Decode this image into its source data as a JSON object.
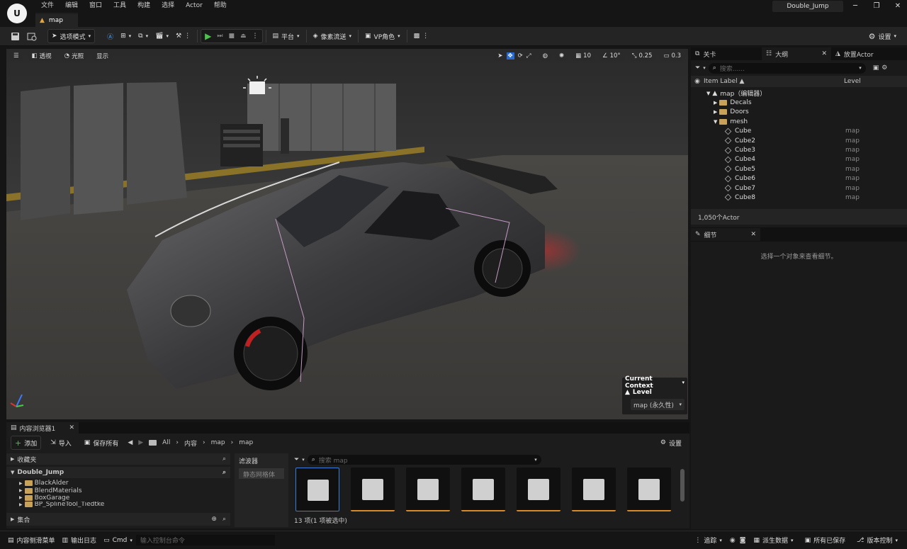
{
  "menu": [
    "文件",
    "编辑",
    "窗口",
    "工具",
    "构建",
    "选择",
    "Actor",
    "帮助"
  ],
  "level_tab": "map",
  "project_name": "Double_Jump",
  "window_controls": {
    "minimize": "─",
    "maximize": "❐",
    "close": "✕"
  },
  "toolbar": {
    "mode": "选项模式",
    "platform": "平台",
    "pixel_streaming": "像素流送",
    "vp_role": "VP角色",
    "settings": "设置"
  },
  "viewport": {
    "perspective": "透视",
    "lit": "光照",
    "show": "显示",
    "grid_snap": "10",
    "rot_snap": "10°",
    "scale_snap": "0.25",
    "cam_speed": "0.3",
    "context_title": "Current Context",
    "context_level_label": "Level",
    "context_level_value": "map (永久性)"
  },
  "right_tabs": {
    "level": "关卡",
    "outliner": "大纲",
    "place": "放置Actor"
  },
  "outliner": {
    "search_placeholder": "搜索......",
    "col_label": "Item Label ▲",
    "col_level": "Level",
    "root": "map（编辑器）",
    "folders": [
      "Decals",
      "Doors",
      "mesh"
    ],
    "items": [
      {
        "name": "Cube",
        "level": "map"
      },
      {
        "name": "Cube2",
        "level": "map"
      },
      {
        "name": "Cube3",
        "level": "map"
      },
      {
        "name": "Cube4",
        "level": "map"
      },
      {
        "name": "Cube5",
        "level": "map"
      },
      {
        "name": "Cube6",
        "level": "map"
      },
      {
        "name": "Cube7",
        "level": "map"
      },
      {
        "name": "Cube8",
        "level": "map"
      }
    ],
    "count": "1,050个Actor"
  },
  "details": {
    "tab": "细节",
    "hint": "选择一个对象来查看细节。"
  },
  "content_browser": {
    "tab": "内容浏览器1",
    "add": "添加",
    "import": "导入",
    "save_all": "保存所有",
    "path": [
      "All",
      "内容",
      "map",
      "map"
    ],
    "settings": "设置",
    "favorites": "收藏夹",
    "project": "Double_Jump",
    "folders": [
      "BlackAlder",
      "BlendMaterials",
      "BoxGarage",
      "BP_SplineTool_Tiedtke"
    ],
    "collections": "集合",
    "filters": "滤波器",
    "filter_chip": "静态网格体",
    "search_placeholder": "搜索 map",
    "asset_count": "13 项(1 项被选中)"
  },
  "status": {
    "drawer": "内容侧滑菜单",
    "log": "输出日志",
    "cmd": "Cmd",
    "cmd_placeholder": "输入控制台命令",
    "trace": "追踪",
    "derived": "派生数据",
    "saved": "所有已保存",
    "vcs": "版本控制"
  }
}
